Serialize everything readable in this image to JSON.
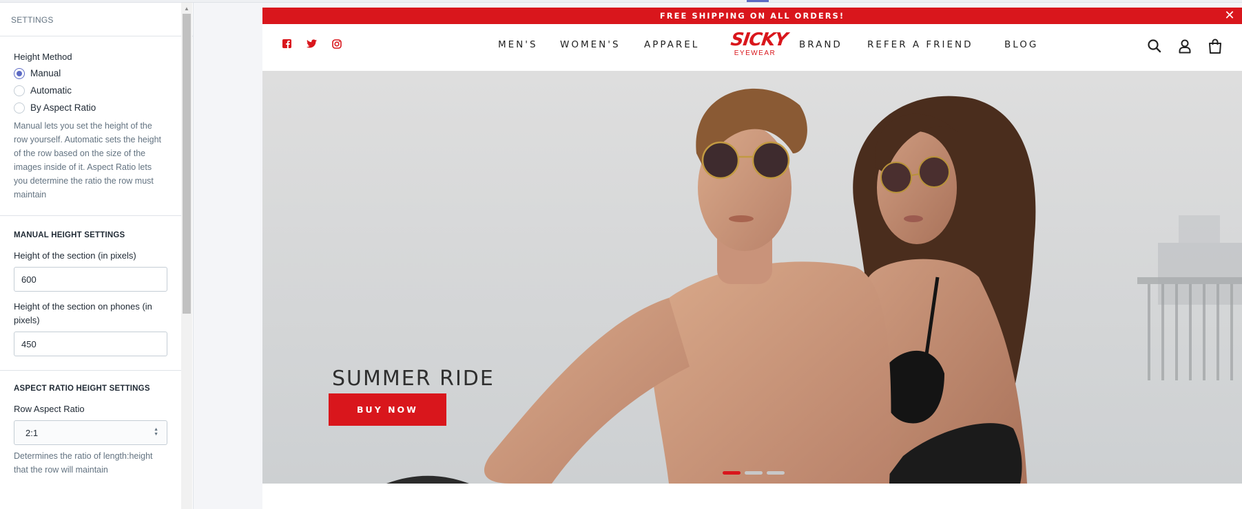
{
  "sidebar": {
    "title": "SETTINGS",
    "height_method": {
      "label": "Height Method",
      "options": [
        "Manual",
        "Automatic",
        "By Aspect Ratio"
      ],
      "selected": "Manual",
      "help": "Manual lets you set the height of the row yourself. Automatic sets the height of the row based on the size of the images inside of it. Aspect Ratio lets you determine the ratio the row must maintain"
    },
    "manual_height": {
      "heading": "MANUAL HEIGHT SETTINGS",
      "section_height_label": "Height of the section (in pixels)",
      "section_height_value": "600",
      "phone_height_label": "Height of the section on phones (in pixels)",
      "phone_height_value": "450"
    },
    "aspect_ratio": {
      "heading": "ASPECT RATIO HEIGHT SETTINGS",
      "row_label": "Row Aspect Ratio",
      "row_value": "2:1",
      "help": "Determines the ratio of length:height that the row will maintain"
    }
  },
  "preview": {
    "announcement": "FREE SHIPPING ON ALL ORDERS!",
    "close_glyph": "✕",
    "social": [
      "facebook-icon",
      "twitter-icon",
      "instagram-icon"
    ],
    "nav_left": [
      "MEN'S",
      "WOMEN'S",
      "APPAREL"
    ],
    "nav_right": [
      "BRAND",
      "REFER A FRIEND",
      "BLOG"
    ],
    "logo": {
      "main": "SICKY",
      "sub": "EYEWEAR"
    },
    "header_icons": [
      "search-icon",
      "account-icon",
      "cart-icon"
    ],
    "hero": {
      "title": "SUMMER RIDE",
      "button": "BUY NOW",
      "slides": 3,
      "active_slide": 1
    },
    "colors": {
      "brand_red": "#d9161c",
      "accent": "#5c6ac4"
    }
  }
}
